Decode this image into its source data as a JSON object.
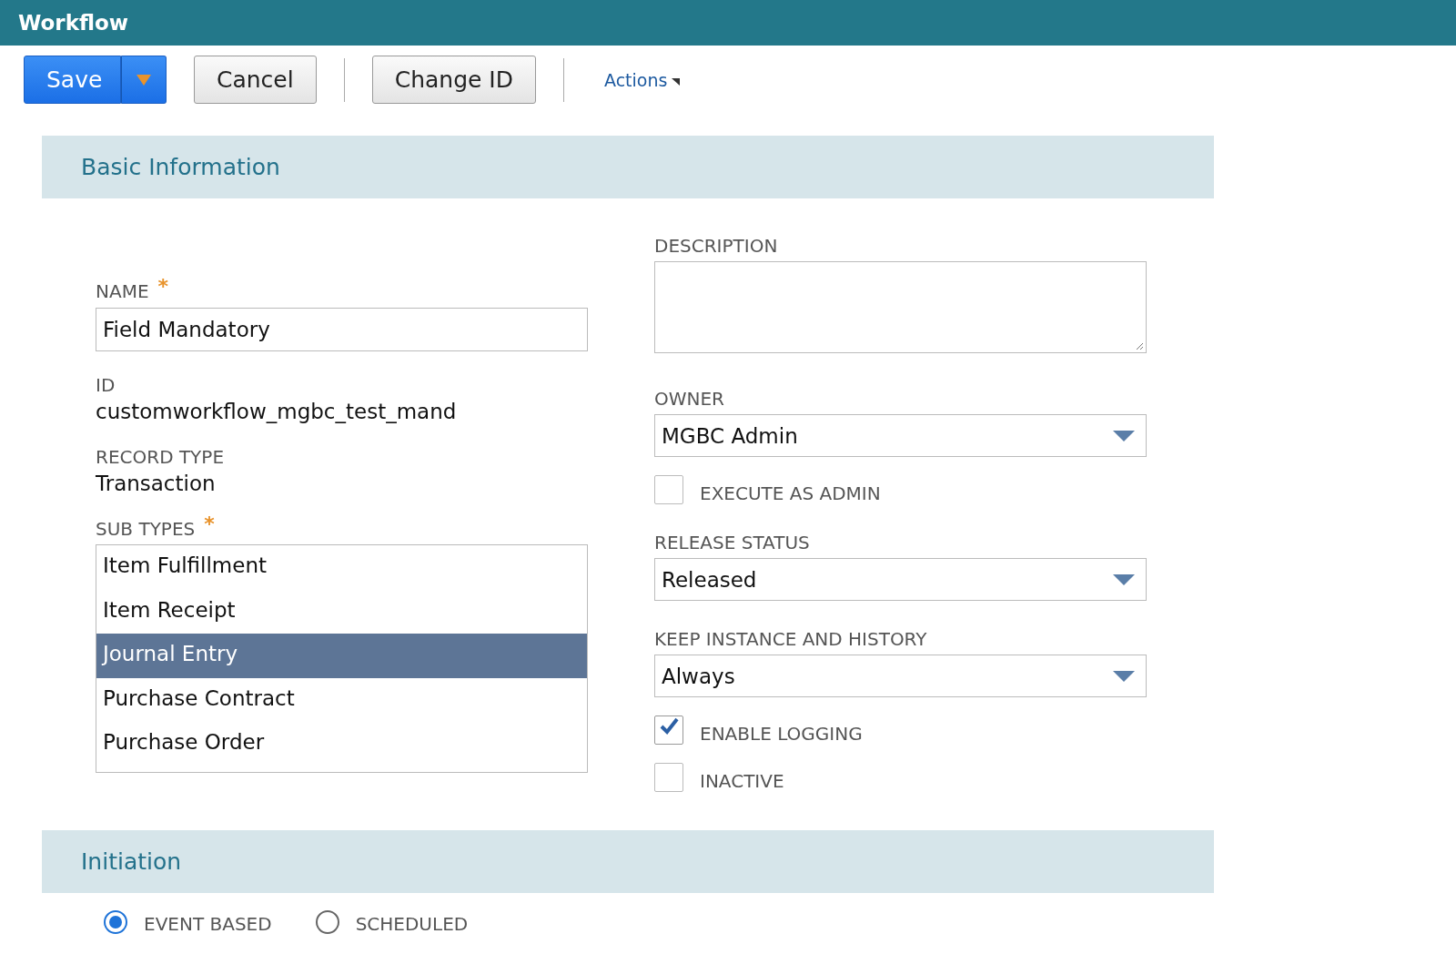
{
  "window": {
    "title": "Workflow"
  },
  "toolbar": {
    "buttons": [
      {
        "label": "Save",
        "kind": "split"
      },
      {
        "label": "Cancel",
        "kind": "plain"
      },
      {
        "label": "Change ID",
        "kind": "plain"
      }
    ],
    "actions": "Actions"
  },
  "basic_information": {
    "title": "Basic Information",
    "name": {
      "label": "NAME",
      "required_mark": "*",
      "value": "Field Mandatory"
    },
    "id": {
      "label": "ID",
      "value": "customworkflow_mgbc_test_mand"
    },
    "record_type": {
      "label": "RECORD TYPE",
      "value": "Transaction"
    },
    "sub_types": {
      "label": "SUB TYPES",
      "required_mark": "*",
      "options": [
        {
          "label": "Item Fulfillment",
          "selected": false
        },
        {
          "label": "Item Receipt",
          "selected": false
        },
        {
          "label": "Journal Entry",
          "selected": true
        },
        {
          "label": "Purchase Contract",
          "selected": false
        },
        {
          "label": "Purchase Order",
          "selected": false
        }
      ]
    },
    "description": {
      "label": "DESCRIPTION"
    },
    "owner": {
      "label": "OWNER",
      "value": "MGBC Admin"
    },
    "execute_as_admin": {
      "label": "EXECUTE AS ADMIN",
      "checked": false
    },
    "release_status": {
      "label": "RELEASE STATUS",
      "value": "Released"
    },
    "keep_instance_and_history": {
      "label": "KEEP INSTANCE AND HISTORY",
      "value": "Always"
    },
    "enable_logging": {
      "label": "ENABLE LOGGING",
      "checked": true
    },
    "inactive": {
      "label": "INACTIVE",
      "checked": false
    }
  },
  "initiation": {
    "title": "Initiation",
    "options": [
      {
        "label": "EVENT BASED",
        "selected": true
      },
      {
        "label": "SCHEDULED",
        "selected": false
      }
    ]
  }
}
